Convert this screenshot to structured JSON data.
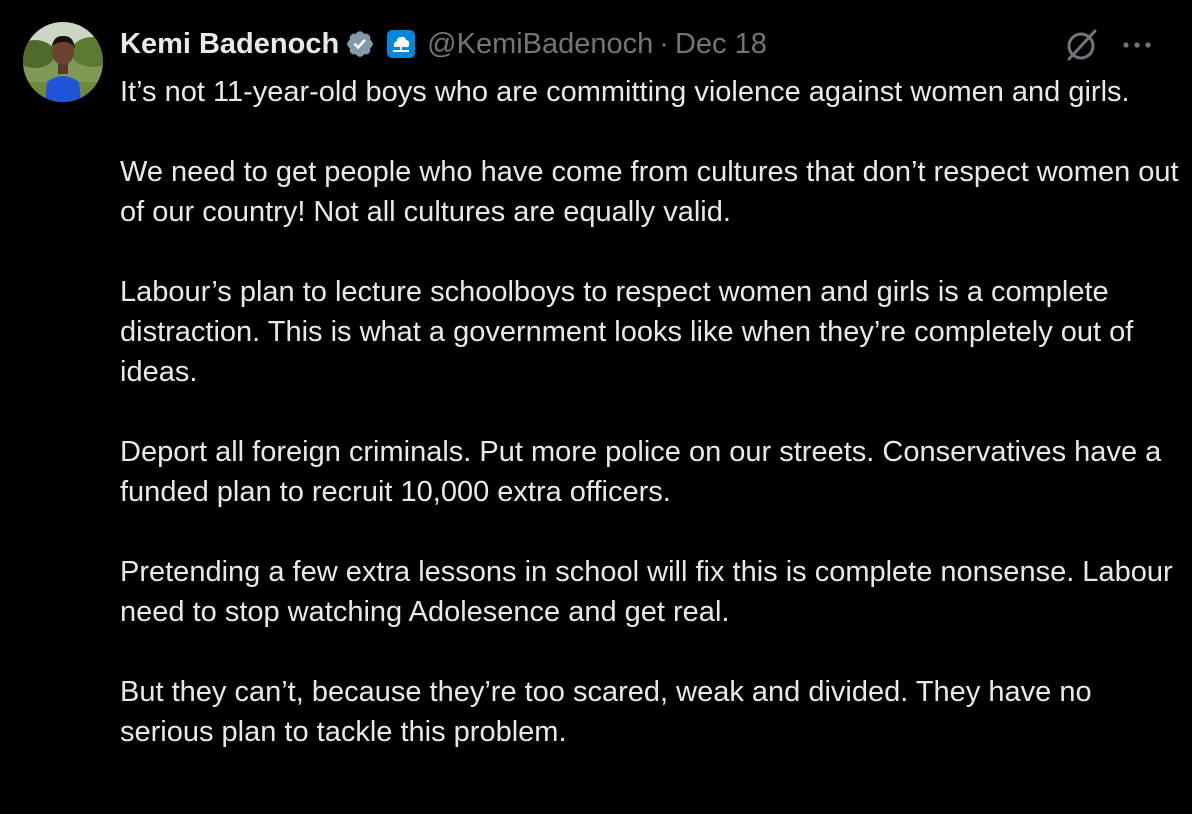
{
  "author": {
    "display_name": "Kemi Badenoch",
    "handle": "@KemiBadenoch",
    "separator": "·",
    "date": "Dec 18"
  },
  "icons": {
    "verified": "verified-badge-icon",
    "affiliate": "conservatives-tree-logo",
    "grok": "grok-icon",
    "more": "more-options-icon"
  },
  "colors": {
    "background": "#000000",
    "text": "#e7e9ea",
    "secondary": "#71767b",
    "verified_badge": "#829aab",
    "affiliate_badge": "#0087dc"
  },
  "tweet": {
    "paragraphs": [
      "It’s not 11-year-old boys who are committing violence against women and girls.",
      "We need to get people who have come from cultures that don’t respect women out of our country! Not all cultures are equally valid.",
      "Labour’s plan to lecture schoolboys to respect women and girls is a complete distraction. This is what a government looks like when they’re completely out of ideas.",
      "Deport all foreign criminals. Put more police on our streets. Conservatives have a funded plan to recruit 10,000 extra officers.",
      "Pretending a few extra lessons in school will fix this is complete nonsense. Labour need to stop watching Adolesence and get real.",
      "But they can’t, because they’re too scared, weak and divided. They have no serious plan to tackle this problem."
    ]
  }
}
